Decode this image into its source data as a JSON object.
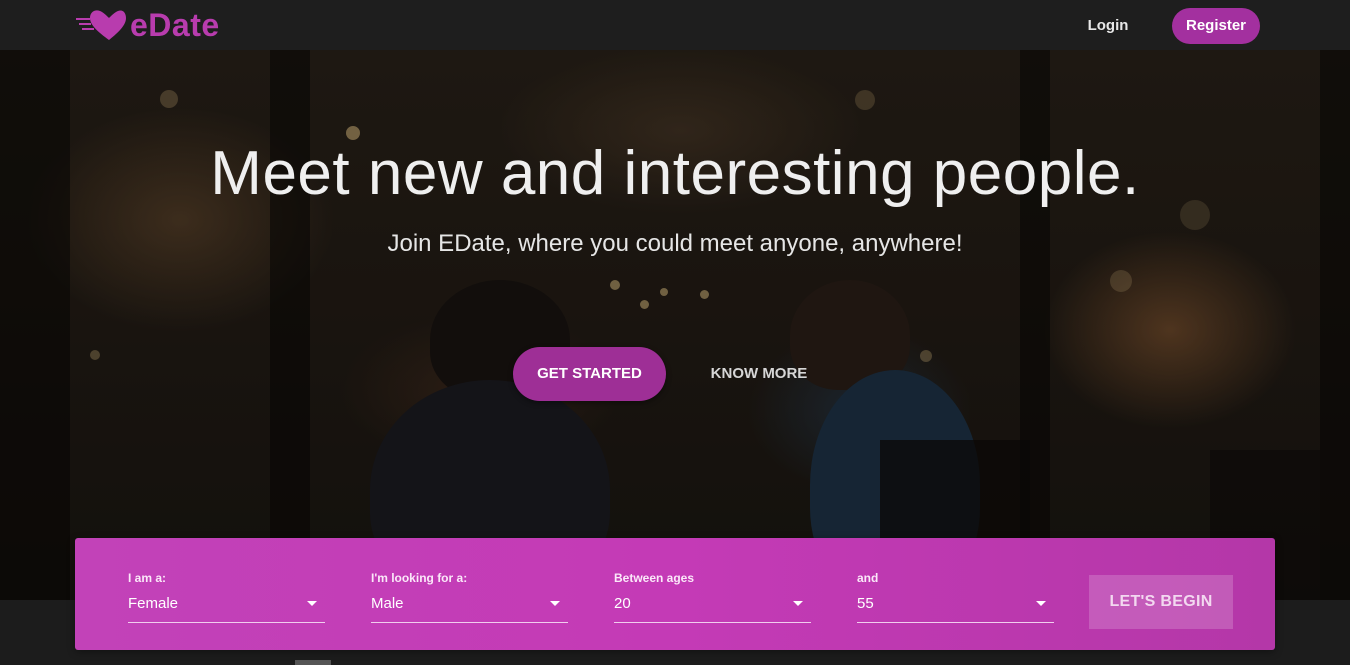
{
  "brand": {
    "name": "eDate",
    "logo_icon": "heart-icon",
    "color": "#b83cae"
  },
  "nav": {
    "login_label": "Login",
    "register_label": "Register"
  },
  "hero": {
    "title": "Meet new and interesting people.",
    "subtitle": "Join EDate, where you could meet anyone, anywhere!",
    "primary_cta": "GET STARTED",
    "secondary_cta": "KNOW MORE"
  },
  "search": {
    "fields": [
      {
        "label": "I am a:",
        "value": "Female"
      },
      {
        "label": "I'm looking for a:",
        "value": "Male"
      },
      {
        "label": "Between ages",
        "value": "20"
      },
      {
        "label": "and",
        "value": "55"
      }
    ],
    "submit_label": "LET'S BEGIN"
  },
  "colors": {
    "accent": "#a3309f",
    "panel": "#c242b8",
    "navbar": "#1e1e1e"
  }
}
